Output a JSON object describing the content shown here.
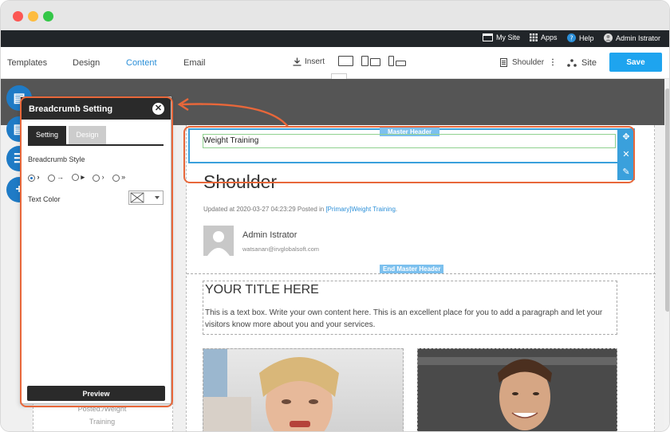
{
  "topbar": {
    "mysite": "My Site",
    "apps": "Apps",
    "help": "Help",
    "user": "Admin Istrator"
  },
  "toolbar": {
    "tabs": [
      "Templates",
      "Design",
      "Content",
      "Email"
    ],
    "active_tab": "Content",
    "insert": "Insert",
    "page_select": "Shoulder",
    "site": "Site",
    "save": "Save"
  },
  "panel": {
    "title": "Breadcrumb Setting",
    "tabs": [
      "Setting",
      "Design"
    ],
    "style_label": "Breadcrumb Style",
    "style_options": [
      "›",
      "→",
      "▸",
      "›",
      "»"
    ],
    "text_color_label": "Text Color",
    "preview": "Preview"
  },
  "page": {
    "master_header_tag": "Master Header",
    "breadcrumb_text": "Weight Training",
    "post_title": "Shoulder",
    "meta_prefix": "Updated at 2020-03-27 04:23:29 Posted in ",
    "meta_link": "[Primary]Weight Training",
    "meta_suffix": ".",
    "author_name": "Admin Istrator",
    "author_email": "watsanan@irvglobalsoft.com",
    "end_master_header_tag": "End Master Header",
    "textbox_title": "YOUR TITLE HERE",
    "textbox_body": "This is a text box. Write your own content here. This is an excellent place for you to add a paragraph and let your visitors know more about you and your services."
  },
  "left_strip": {
    "text_line1": "Posted:/Weight",
    "text_line2": "Training"
  },
  "colors": {
    "accent": "#1ea4ef",
    "highlight": "#e8673a",
    "panel_dark": "#2a2a2a",
    "master_tag": "#7cc0ee"
  }
}
